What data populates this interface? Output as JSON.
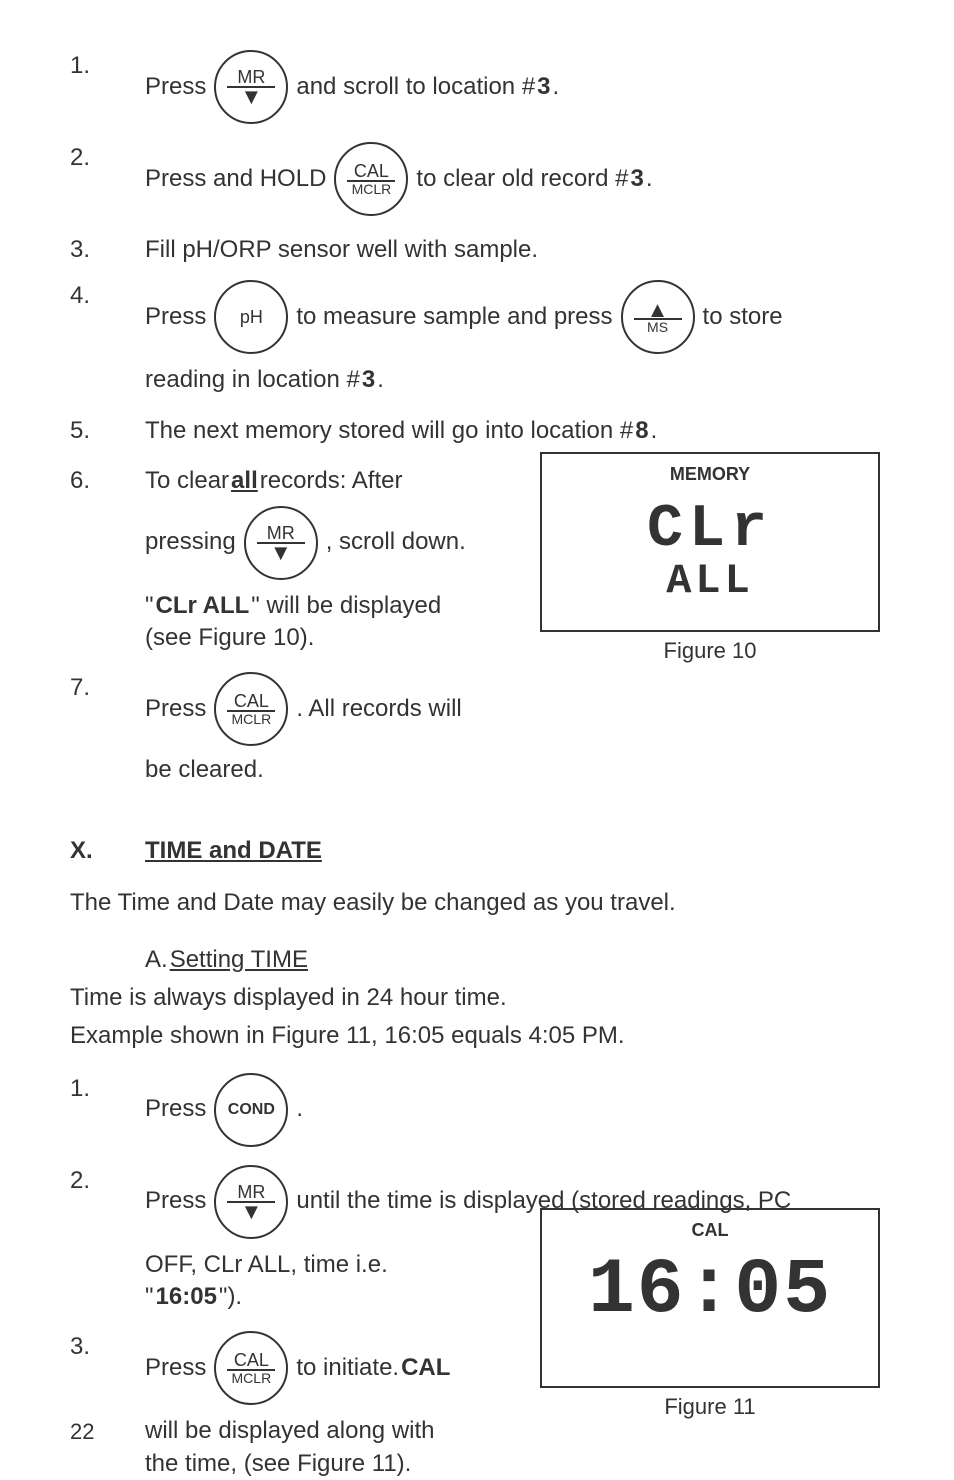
{
  "steps_top": [
    {
      "num": "1.",
      "t1": "Press ",
      "btn": {
        "top": "MR",
        "arrow": "▼"
      },
      "t2": " and scroll to location #",
      "bold": "3",
      "t3": "."
    },
    {
      "num": "2.",
      "t1": "Press and HOLD ",
      "btn": {
        "top": "CAL",
        "bottom": "MCLR"
      },
      "t2": " to clear old record #",
      "bold": "3",
      "t3": "."
    },
    {
      "num": "3.",
      "t1": "Fill pH/ORP sensor well with sample."
    },
    {
      "num": "4.",
      "t1": "Press ",
      "btn1": {
        "mid": "pH"
      },
      "t2": " to measure sample and press ",
      "btn2": {
        "arrow": "▲",
        "bottom": "MS"
      },
      "t3": " to store",
      "cont": "reading in location #",
      "bold": "3",
      "t4": "."
    },
    {
      "num": "5.",
      "t1": "The next memory stored will go into location #",
      "bold": "8",
      "t2": "."
    },
    {
      "num": "6.",
      "t1": "To clear ",
      "allword": "all",
      "t2": " records: After",
      "line2a": "pressing ",
      "btn": {
        "top": "MR",
        "arrow": "▼"
      },
      "line2b": ", scroll down.",
      "line3a": "\"",
      "clr": "CLr ALL",
      "line3b": "\" will be displayed",
      "line4": "(see Figure 10)."
    },
    {
      "num": "7.",
      "t1": "Press ",
      "btn": {
        "top": "CAL",
        "bottom": "MCLR"
      },
      "t2": ". All records will",
      "cont": "be cleared."
    }
  ],
  "fig10": {
    "label": "MEMORY",
    "big": "CLr",
    "small": "ALL",
    "cap": "Figure 10"
  },
  "sectionX": {
    "num": "X.",
    "title": "TIME and DATE"
  },
  "paraX": "The Time and Date may easily be changed as you travel.",
  "subA": {
    "label": "A. ",
    "title": "Setting TIME"
  },
  "time_p1": "Time is always displayed in 24 hour time.",
  "time_p2": "Example shown in Figure 11, 16:05 equals 4:05 PM.",
  "steps_bottom": [
    {
      "num": "1.",
      "t1": "Press ",
      "btn": {
        "mid": "COND"
      },
      "t2": "."
    },
    {
      "num": "2.",
      "t1": "Press ",
      "btn": {
        "top": "MR",
        "arrow": "▼"
      },
      "t2": " until the time is displayed (stored readings, PC",
      "cont1": "OFF, CLr ALL,  time i.e.",
      "cont2a": "\"",
      "cont2b": "16:05",
      "cont2c": "\")."
    },
    {
      "num": "3.",
      "t1": "Press ",
      "btn": {
        "top": "CAL",
        "bottom": "MCLR"
      },
      "t2": " to initiate. ",
      "bold": "CAL",
      "cont1": "will be displayed along with",
      "cont2": "the time, (see Figure 11)."
    }
  ],
  "fig11": {
    "label": "CAL",
    "big": "16:05",
    "cap": "Figure 11"
  },
  "page": "22"
}
